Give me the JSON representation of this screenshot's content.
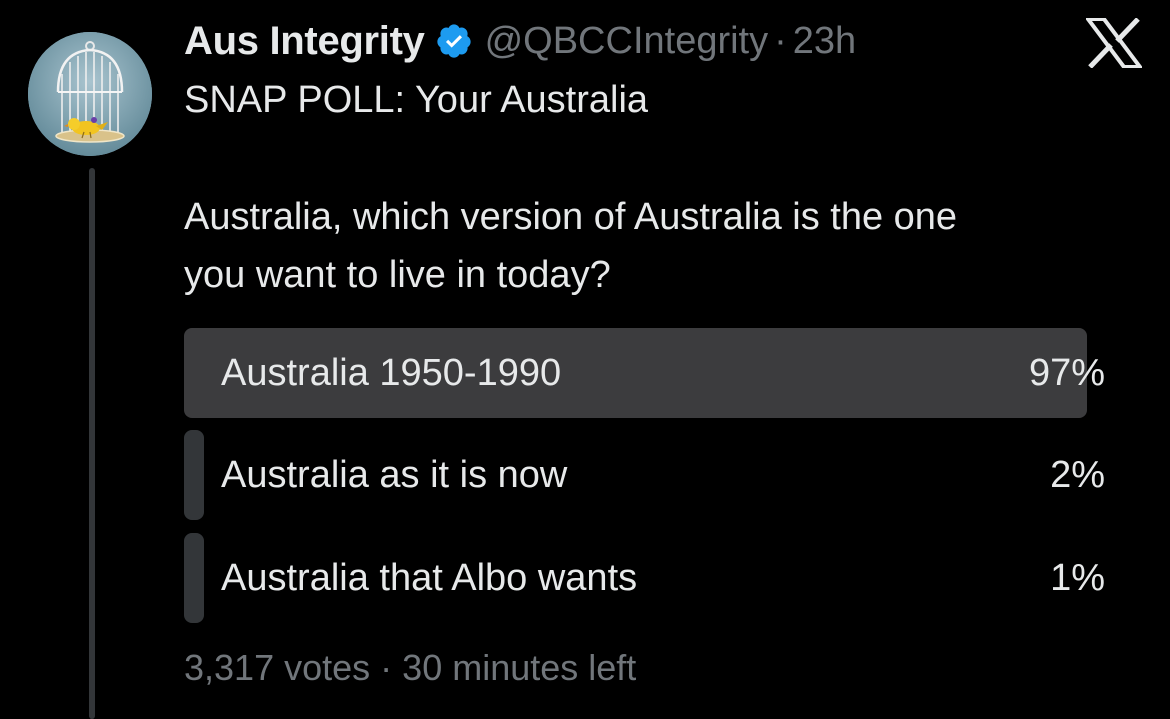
{
  "tweet": {
    "display_name": "Aus Integrity",
    "handle": "@QBCCIntegrity",
    "separator": "·",
    "time": "23h",
    "verified": true,
    "text_line_1": "SNAP POLL: Your Australia",
    "text_line_2": "Australia, which version of Australia is the one",
    "text_line_3": "you want to live in today?"
  },
  "poll": {
    "options": [
      {
        "label": "Australia 1950-1990",
        "percent": "97%",
        "fraction": 0.97
      },
      {
        "label": "Australia as it is now",
        "percent": "2%",
        "fraction": 0.02
      },
      {
        "label": "Australia that Albo wants",
        "percent": "1%",
        "fraction": 0.01
      }
    ],
    "votes": "3,317 votes",
    "footer_separator": "·",
    "time_left": "30 minutes left"
  },
  "icons": {
    "avatar": "birdcage-avatar",
    "verified": "verified-badge-icon",
    "brand": "x-logo-icon"
  },
  "colors": {
    "background": "#000000",
    "primary_text": "#e7e9ea",
    "secondary_text": "#71767b",
    "verified_badge": "#1d9bf0",
    "poll_winner_fill": "#3c3c3e",
    "poll_other_fill": "#333639"
  }
}
